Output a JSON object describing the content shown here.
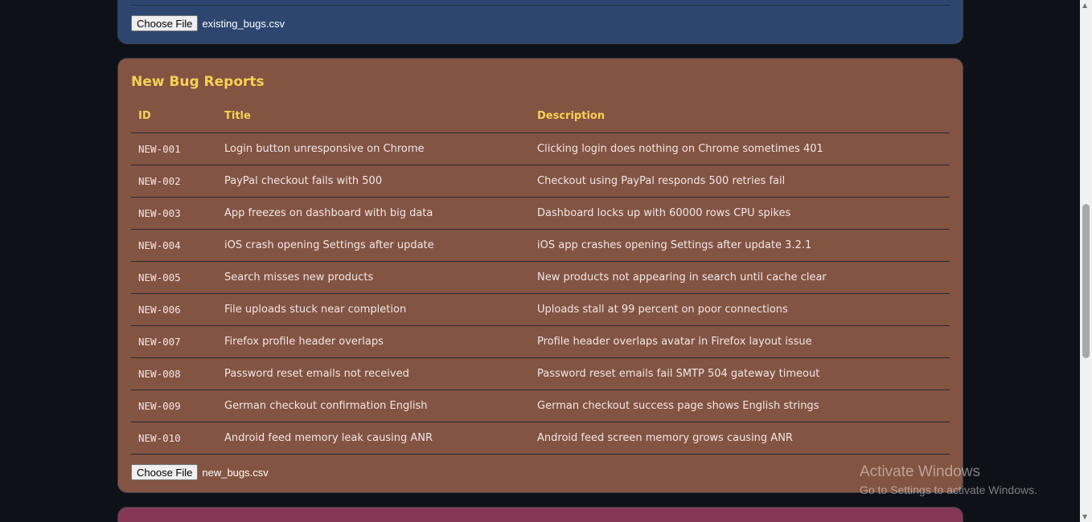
{
  "existing": {
    "button": "Choose File",
    "file": "existing_bugs.csv"
  },
  "new_reports": {
    "title": "New Bug Reports",
    "columns": [
      "ID",
      "Title",
      "Description"
    ],
    "rows": [
      [
        "NEW-001",
        "Login button unresponsive on Chrome",
        "Clicking login does nothing on Chrome sometimes 401"
      ],
      [
        "NEW-002",
        "PayPal checkout fails with 500",
        "Checkout using PayPal responds 500 retries fail"
      ],
      [
        "NEW-003",
        "App freezes on dashboard with big data",
        "Dashboard locks up with 60000 rows CPU spikes"
      ],
      [
        "NEW-004",
        "iOS crash opening Settings after update",
        "iOS app crashes opening Settings after update 3.2.1"
      ],
      [
        "NEW-005",
        "Search misses new products",
        "New products not appearing in search until cache clear"
      ],
      [
        "NEW-006",
        "File uploads stuck near completion",
        "Uploads stall at 99 percent on poor connections"
      ],
      [
        "NEW-007",
        "Firefox profile header overlaps",
        "Profile header overlaps avatar in Firefox layout issue"
      ],
      [
        "NEW-008",
        "Password reset emails not received",
        "Password reset emails fail SMTP 504 gateway timeout"
      ],
      [
        "NEW-009",
        "German checkout confirmation English",
        "German checkout success page shows English strings"
      ],
      [
        "NEW-010",
        "Android feed memory leak causing ANR",
        "Android feed screen memory grows causing ANR"
      ]
    ],
    "button": "Choose File",
    "file": "new_bugs.csv"
  },
  "watermark": {
    "title": "Activate Windows",
    "subtitle": "Go to Settings to activate Windows."
  }
}
